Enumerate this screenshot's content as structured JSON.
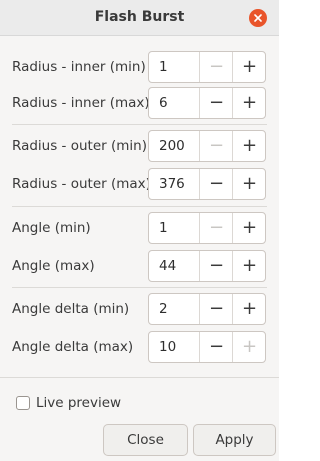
{
  "window": {
    "title": "Flash Burst"
  },
  "fields": [
    {
      "label": "Radius - inner (min)",
      "value": "1",
      "minus_enabled": false,
      "plus_enabled": true
    },
    {
      "label": "Radius - inner (max)",
      "value": "6",
      "minus_enabled": true,
      "plus_enabled": true
    },
    {
      "label": "Radius - outer (min)",
      "value": "200",
      "minus_enabled": false,
      "plus_enabled": true
    },
    {
      "label": "Radius - outer (max)",
      "value": "376",
      "minus_enabled": true,
      "plus_enabled": true
    },
    {
      "label": "Angle (min)",
      "value": "1",
      "minus_enabled": false,
      "plus_enabled": true
    },
    {
      "label": "Angle (max)",
      "value": "44",
      "minus_enabled": true,
      "plus_enabled": true
    },
    {
      "label": "Angle delta (min)",
      "value": "2",
      "minus_enabled": true,
      "plus_enabled": true
    },
    {
      "label": "Angle delta (max)",
      "value": "10",
      "minus_enabled": true,
      "plus_enabled": false
    }
  ],
  "spin": {
    "minus_glyph": "−",
    "plus_glyph": "+"
  },
  "live_preview": {
    "label": "Live preview",
    "checked": false
  },
  "buttons": {
    "close_label": "Close",
    "apply_label": "Apply"
  },
  "colors": {
    "close_accent": "#e9542a"
  }
}
